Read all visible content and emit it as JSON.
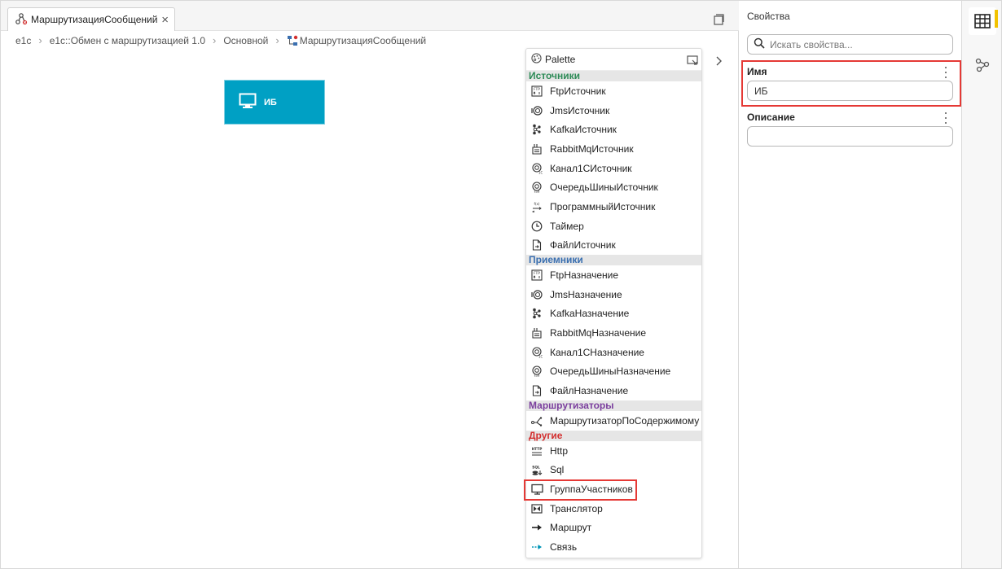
{
  "tab": {
    "title": "МаршрутизацияСообщений",
    "close": "×"
  },
  "breadcrumb": [
    "e1c",
    "e1c::Обмен с маршрутизацией 1.0",
    "Основной",
    "МаршрутизацияСообщений"
  ],
  "canvas": {
    "node_label": "ИБ",
    "node_color": "#00a0c4"
  },
  "palette": {
    "title": "Palette",
    "sections": [
      {
        "label": "Источники",
        "color": "#2e8b57",
        "items": [
          {
            "label": "FtpИсточник",
            "icon": "ftp-icon"
          },
          {
            "label": "JmsИсточник",
            "icon": "jms-icon"
          },
          {
            "label": "KafkaИсточник",
            "icon": "kafka-icon"
          },
          {
            "label": "RabbitMqИсточник",
            "icon": "rabbitmq-icon"
          },
          {
            "label": "Канал1СИсточник",
            "icon": "channel-1c-icon"
          },
          {
            "label": "ОчередьШиныИсточник",
            "icon": "bus-queue-icon"
          },
          {
            "label": "ПрограммныйИсточник",
            "icon": "program-icon"
          },
          {
            "label": "Таймер",
            "icon": "clock-icon"
          },
          {
            "label": "ФайлИсточник",
            "icon": "file-icon"
          }
        ]
      },
      {
        "label": "Приемники",
        "color": "#3a6fb0",
        "items": [
          {
            "label": "FtpНазначение",
            "icon": "ftp-icon"
          },
          {
            "label": "JmsНазначение",
            "icon": "jms-icon"
          },
          {
            "label": "KafkaНазначение",
            "icon": "kafka-icon"
          },
          {
            "label": "RabbitMqНазначение",
            "icon": "rabbitmq-icon"
          },
          {
            "label": "Канал1СНазначение",
            "icon": "channel-1c-icon"
          },
          {
            "label": "ОчередьШиныНазначение",
            "icon": "bus-queue-icon"
          },
          {
            "label": "ФайлНазначение",
            "icon": "file-icon"
          }
        ]
      },
      {
        "label": "Маршрутизаторы",
        "color": "#7b3f9e",
        "items": [
          {
            "label": "МаршрутизаторПоСодержимому",
            "icon": "router-icon"
          }
        ]
      },
      {
        "label": "Другие",
        "color": "#d32f2f",
        "items": [
          {
            "label": "Http",
            "icon": "http-icon"
          },
          {
            "label": "Sql",
            "icon": "sql-icon"
          },
          {
            "label": "ГруппаУчастников",
            "icon": "monitor-icon"
          },
          {
            "label": "Транслятор",
            "icon": "translator-icon"
          },
          {
            "label": "Маршрут",
            "icon": "arrow-icon"
          },
          {
            "label": "Связь",
            "icon": "link-icon"
          }
        ]
      }
    ]
  },
  "properties": {
    "title": "Свойства",
    "search_placeholder": "Искать свойства...",
    "name_label": "Имя",
    "name_value": "ИБ",
    "description_label": "Описание",
    "description_value": ""
  },
  "colors": {
    "highlight": "#e53935",
    "accent": "#f2c200"
  }
}
